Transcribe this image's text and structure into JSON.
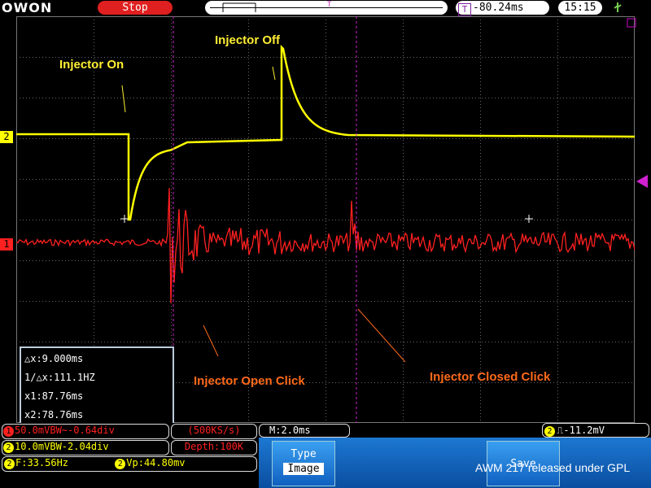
{
  "header": {
    "logo": "OWON",
    "run_state": "Stop",
    "trigger_offset": "-80.24ms",
    "time": "15:15",
    "usb_icon": "usb-icon"
  },
  "markers": {
    "ch2": "2",
    "ch1": "1"
  },
  "annotations": {
    "injector_on": "Injector On",
    "injector_off": "Injector Off",
    "open_click": "Injector Open Click",
    "closed_click": "Injector  Closed Click"
  },
  "cursor_measure": {
    "dx": "△x:9.000ms",
    "inv_dx": "1/△x:111.1HZ",
    "x1": "x1:87.76ms",
    "x2": "x2:78.76ms"
  },
  "status": {
    "ch1_scale": "50.0mVBW~-0.64div",
    "ch2_scale": "10.0mVBW-2.04div",
    "sample_rate": "(500KS/s)",
    "depth": "Depth:100K",
    "timebase": "M:2.0ms",
    "trigger": "-11.2mV",
    "freq": "F:33.56Hz",
    "vp": "Vp:44.80mv"
  },
  "menu": {
    "type_label": "Type",
    "type_value": "Image",
    "save_label": "Save",
    "watermark": "AWM 217 released under GPL"
  },
  "colors": {
    "ch1": "#ff2020",
    "ch2": "#ffff00",
    "cursor": "#d020d0",
    "annotation_yellow": "#ffee33",
    "annotation_orange": "#ff6a1a"
  }
}
